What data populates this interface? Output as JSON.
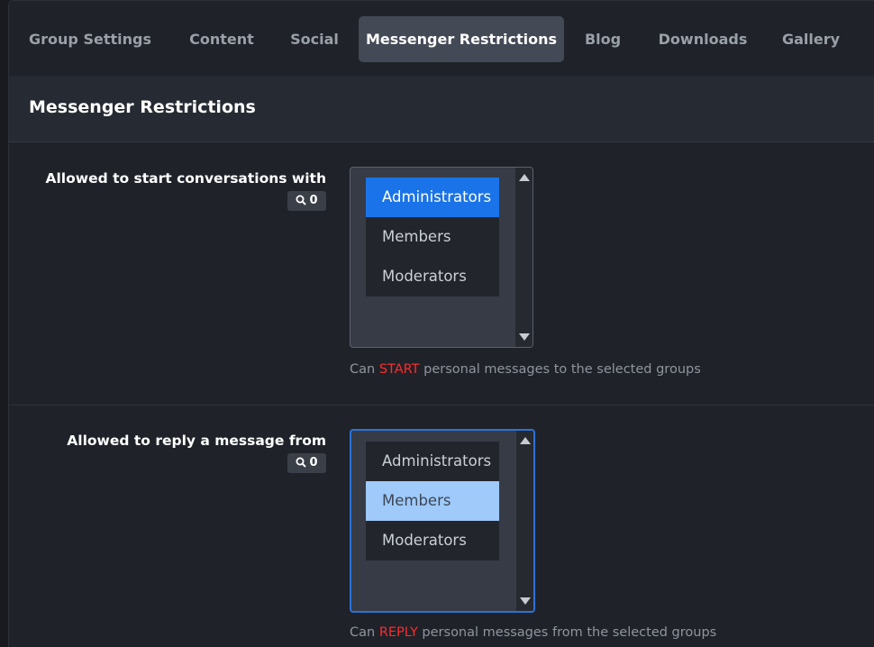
{
  "tabs": [
    {
      "label": "Group Settings",
      "active": false
    },
    {
      "label": "Content",
      "active": false
    },
    {
      "label": "Social",
      "active": false
    },
    {
      "label": "Messenger Restrictions",
      "active": true
    },
    {
      "label": "Blog",
      "active": false
    },
    {
      "label": "Downloads",
      "active": false
    },
    {
      "label": "Gallery",
      "active": false
    }
  ],
  "section": {
    "title": "Messenger Restrictions"
  },
  "fields": [
    {
      "label": "Allowed to start conversations with",
      "selected_count": "0",
      "options": [
        "Administrators",
        "Members",
        "Moderators"
      ],
      "selected": "Administrators",
      "help_prefix": "Can ",
      "help_keyword": "START",
      "help_suffix": " personal messages to the selected groups"
    },
    {
      "label": "Allowed to reply a message from",
      "selected_count": "0",
      "options": [
        "Administrators",
        "Members",
        "Moderators"
      ],
      "selected": "Members",
      "help_prefix": "Can ",
      "help_keyword": "REPLY",
      "help_suffix": " personal messages from the selected groups"
    }
  ],
  "colors": {
    "accent": "#1a73e8",
    "keyword": "#ff2a2a",
    "active_tab": "#434955"
  },
  "icons": {
    "count_badge": "search-icon"
  }
}
